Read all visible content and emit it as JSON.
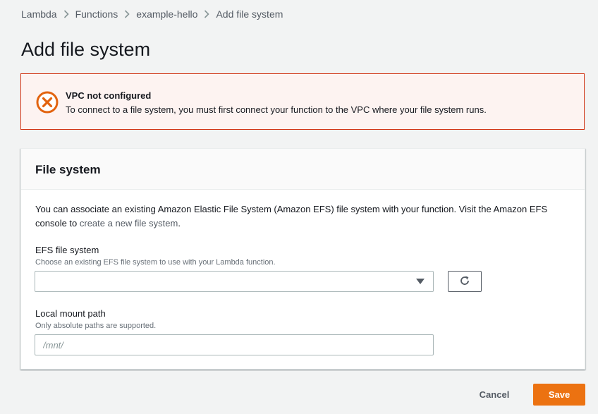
{
  "breadcrumb": {
    "items": [
      "Lambda",
      "Functions",
      "example-hello"
    ],
    "current": "Add file system"
  },
  "page": {
    "title": "Add file system"
  },
  "alert": {
    "title": "VPC not configured",
    "message": "To connect to a file system, you must first connect your function to the VPC where your file system runs.",
    "icon": "error-circle-x-icon",
    "color": "#d13212"
  },
  "panel": {
    "title": "File system",
    "description_prefix": "You can associate an existing Amazon Elastic File System (Amazon EFS) file system with your function. Visit the Amazon EFS console to ",
    "description_link": "create a new file system",
    "description_suffix": "."
  },
  "efs": {
    "label": "EFS file system",
    "hint": "Choose an existing EFS file system to use with your Lambda function.",
    "value": "",
    "refresh_icon": "refresh-icon"
  },
  "mount": {
    "label": "Local mount path",
    "hint": "Only absolute paths are supported.",
    "placeholder": "/mnt/",
    "value": ""
  },
  "actions": {
    "cancel": "Cancel",
    "save": "Save",
    "accent": "#ec7211"
  }
}
